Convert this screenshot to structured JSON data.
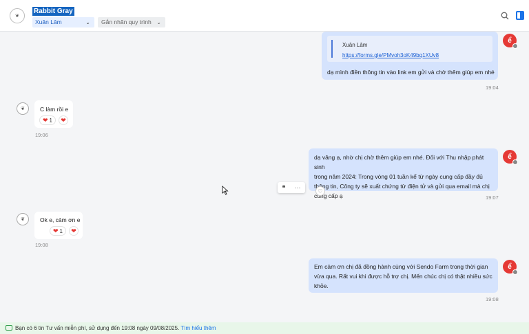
{
  "header": {
    "contact_name": "Rabbit Gray",
    "assignee": "Xuân Lâm",
    "label_placeholder": "Gắn nhãn quy trình"
  },
  "messages": [
    {
      "direction": "out",
      "quote_author": "Xuân Lâm",
      "quote_link": "https://forms.gle/PMvoh3oK49bq1XUv8",
      "text": "dạ mình điền thông tin vào link em gửi và chờ thêm giúp em nhé",
      "time": "19:04"
    },
    {
      "direction": "in",
      "text": "C làm rồi e",
      "reaction_count": "1",
      "time": "19:06"
    },
    {
      "direction": "out",
      "lines": [
        "dạ vâng ạ, nhờ chị chờ thêm giúp em nhé. Đối với Thu nhập phát sinh",
        "trong năm 2024: Trong vòng 01 tuần kể từ ngày cung cấp đầy đủ",
        "thông tin, Công ty sẽ xuất chứng từ điện tử và gửi qua email mà chị",
        "cung cấp ạ"
      ],
      "time": "19:07"
    },
    {
      "direction": "in",
      "text": "Ok e, cảm ơn e",
      "reaction_count": "1",
      "time": "19:08"
    },
    {
      "direction": "out",
      "lines": [
        "Em cảm ơn chị đã đồng hành cùng với Sendo Farm trong thời gian",
        "vừa qua. Rất vui khi được hỗ trợ chị. Mến chúc chị có thật nhiều sức",
        "khỏe."
      ],
      "time": "19:08"
    }
  ],
  "footer": {
    "text": "Bạn có 6 tin Tư vấn miễn phí, sử dụng đến 19:08 ngày 09/08/2025.",
    "link": "Tìm hiểu thêm"
  },
  "icons": {
    "search": "search-icon",
    "panel": "side-panel-icon",
    "quote": "quote-icon",
    "more": "more-icon",
    "heart": "heart-icon"
  },
  "colors": {
    "accent": "#1a73e8",
    "outgoing_bubble": "#d5e3fd",
    "agent_avatar": "#e53935",
    "footer_bg": "#e8f6e9"
  }
}
